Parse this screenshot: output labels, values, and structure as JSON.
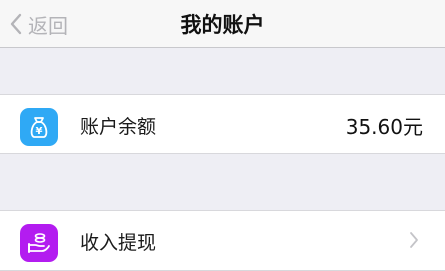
{
  "navbar": {
    "back_label": "返回",
    "title": "我的账户",
    "back_icon": "chevron-left-icon"
  },
  "balance": {
    "label": "账户余额",
    "value": "35.60元",
    "icon": "money-bag-icon",
    "icon_color": "#2fa9f5"
  },
  "withdraw": {
    "label": "收入提现",
    "icon": "hand-coins-icon",
    "icon_color": "#b31cf0",
    "chevron_icon": "chevron-right-icon"
  },
  "colors": {
    "background": "#eeeef4",
    "navbar": "#f7f7f7",
    "back_text": "#b4b4b8"
  }
}
